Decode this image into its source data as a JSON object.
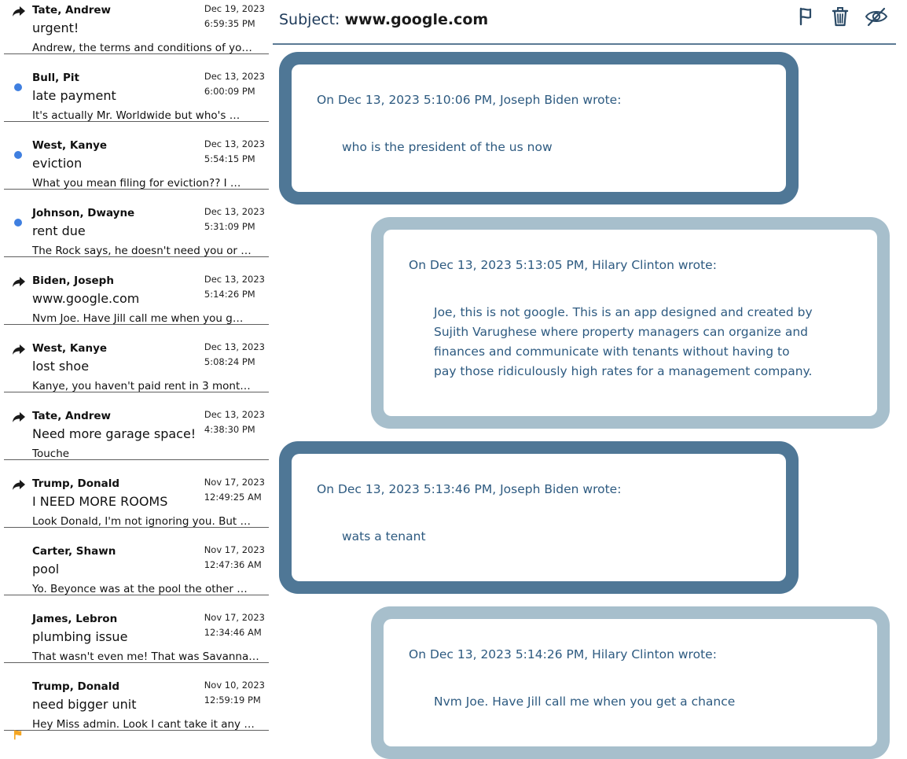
{
  "colors": {
    "unread_dot": "#3f7fe0",
    "flag": "#f5a623",
    "dark_bubble": "#4f7796",
    "light_bubble": "#a7bfcc",
    "text_blue": "#2d5a80"
  },
  "messages": [
    {
      "sender": "Tate, Andrew",
      "subject": "urgent!",
      "preview": "Andrew, the terms and conditions of yo…",
      "date": "Dec 19, 2023",
      "time": "6:59:35 PM",
      "icon": "reply-icon"
    },
    {
      "sender": "Bull, Pit",
      "subject": "late payment",
      "preview": "It's actually Mr. Worldwide but who's …",
      "date": "Dec 13, 2023",
      "time": "6:00:09 PM",
      "icon": "unread-dot"
    },
    {
      "sender": "West, Kanye",
      "subject": "eviction",
      "preview": "What you mean filing for eviction?? I …",
      "date": "Dec 13, 2023",
      "time": "5:54:15 PM",
      "icon": "unread-dot"
    },
    {
      "sender": "Johnson, Dwayne",
      "subject": "rent due",
      "preview": "The Rock says, he doesn't need you or …",
      "date": "Dec 13, 2023",
      "time": "5:31:09 PM",
      "icon": "unread-dot"
    },
    {
      "sender": "Biden, Joseph",
      "subject": "www.google.com",
      "preview": "Nvm Joe. Have Jill call me when you g…",
      "date": "Dec 13, 2023",
      "time": "5:14:26 PM",
      "icon": "reply-icon"
    },
    {
      "sender": "West, Kanye",
      "subject": "lost shoe",
      "preview": "Kanye, you haven't paid rent in 3 mont…",
      "date": "Dec 13, 2023",
      "time": "5:08:24 PM",
      "icon": "reply-icon"
    },
    {
      "sender": "Tate, Andrew",
      "subject": "Need more garage space!",
      "preview": "Touche",
      "date": "Dec 13, 2023",
      "time": "4:38:30 PM",
      "icon": "reply-icon"
    },
    {
      "sender": "Trump, Donald",
      "subject": "I NEED MORE ROOMS",
      "preview": "Look Donald, I'm not ignoring you. But …",
      "date": "Nov 17, 2023",
      "time": "12:49:25 AM",
      "icon": "reply-icon"
    },
    {
      "sender": "Carter, Shawn",
      "subject": "pool",
      "preview": "Yo. Beyonce was at the pool the other …",
      "date": "Nov 17, 2023",
      "time": "12:47:36 AM",
      "icon": ""
    },
    {
      "sender": "James, Lebron",
      "subject": "plumbing issue",
      "preview": "That wasn't even me! That was Savanna…",
      "date": "Nov 17, 2023",
      "time": "12:34:46 AM",
      "icon": ""
    },
    {
      "sender": "Trump, Donald",
      "subject": "need bigger unit",
      "preview": "Hey Miss admin. Look I cant take it any …",
      "date": "Nov 10, 2023",
      "time": "12:59:19 PM",
      "icon": "flag-icon"
    }
  ],
  "viewer": {
    "subject_label": "Subject:",
    "subject_value": "www.google.com",
    "tools": [
      {
        "name": "flag-button",
        "icon": "flag-icon"
      },
      {
        "name": "delete-button",
        "icon": "trash-icon"
      },
      {
        "name": "hide-button",
        "icon": "eye-off-icon"
      }
    ],
    "thread": [
      {
        "attribution": "On Dec 13, 2023 5:10:06 PM, Joseph Biden wrote:",
        "body": [
          "who is the president of the us now"
        ],
        "style": "dark"
      },
      {
        "attribution": "On Dec 13, 2023 5:13:05 PM, Hilary Clinton wrote:",
        "body": [
          "Joe, this is not google. This is an app designed and created by",
          "Sujith Varughese where property managers can organize and",
          "finances and communicate with tenants without having to",
          "pay those ridiculously high rates for a management company."
        ],
        "style": "light"
      },
      {
        "attribution": "On Dec 13, 2023 5:13:46 PM, Joseph Biden wrote:",
        "body": [
          "wats a tenant"
        ],
        "style": "dark"
      },
      {
        "attribution": "On Dec 13, 2023 5:14:26 PM, Hilary Clinton wrote:",
        "body": [
          "Nvm Joe. Have Jill call me when you get a chance"
        ],
        "style": "light"
      }
    ]
  }
}
